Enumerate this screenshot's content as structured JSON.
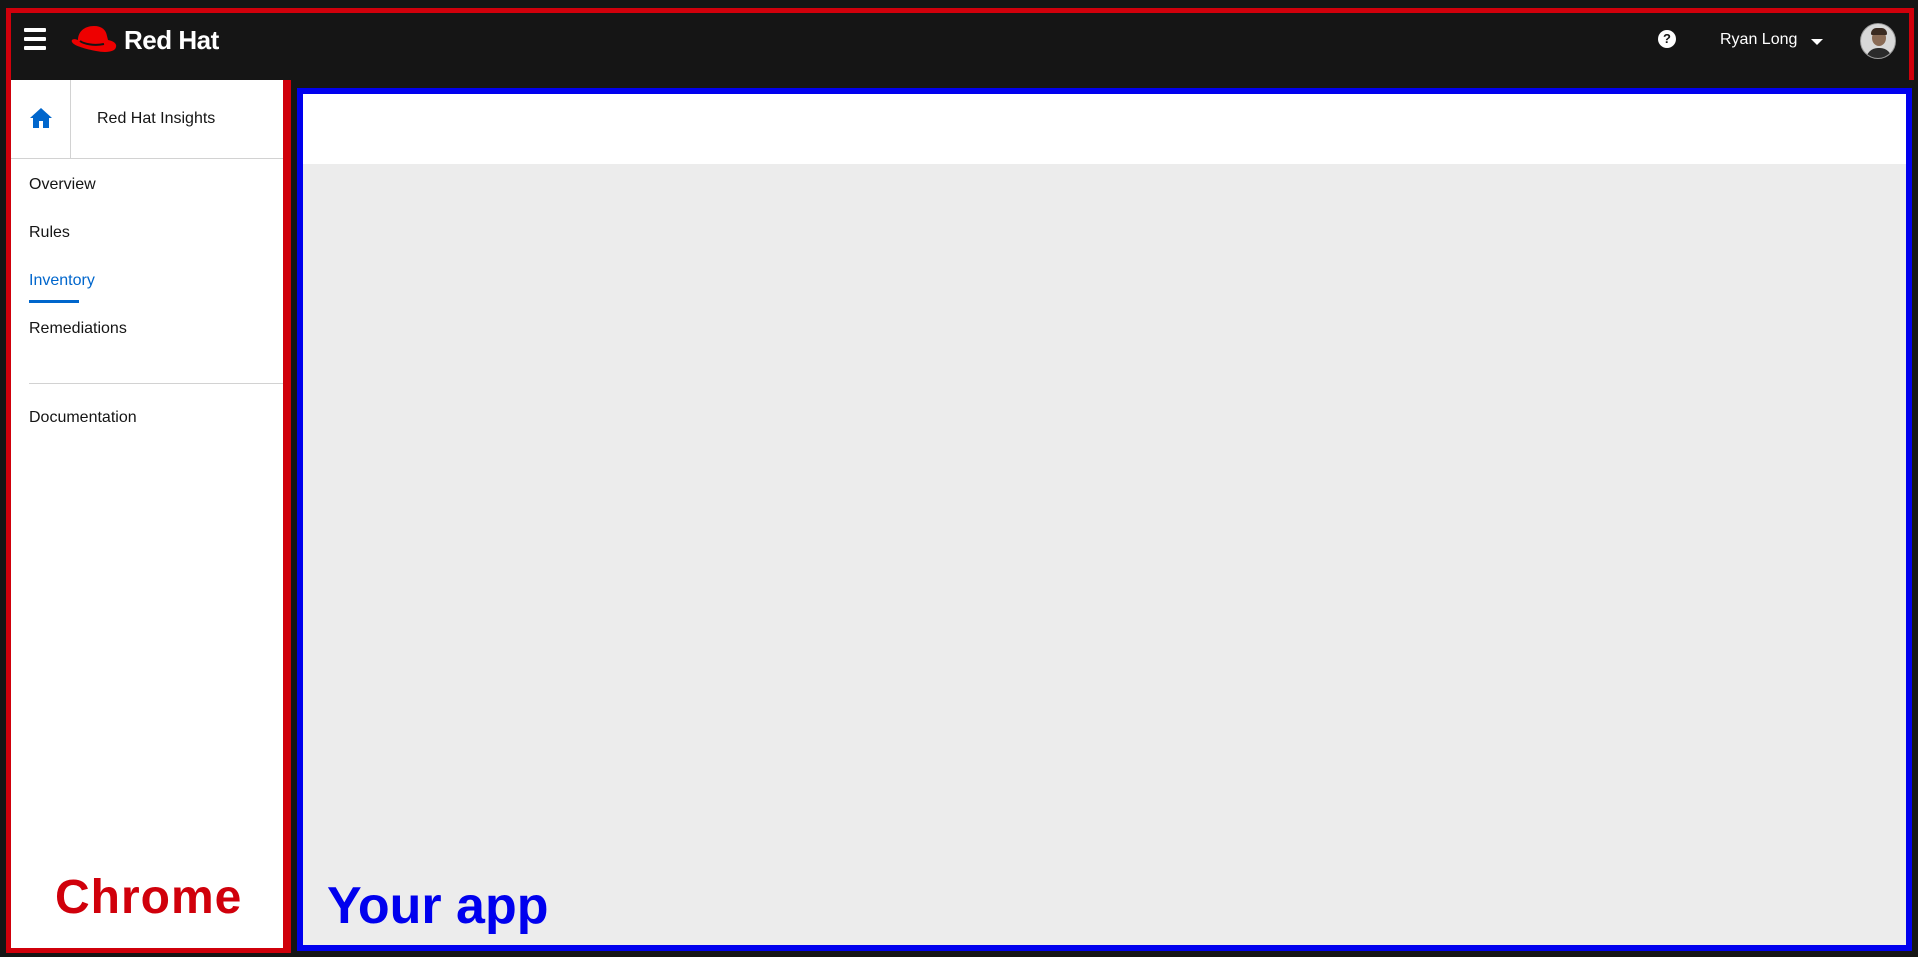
{
  "masthead": {
    "brand": "Red Hat",
    "user_name": "Ryan Long",
    "help_icon": "?",
    "icons": [
      "hamburger-icon",
      "redhat-logo-icon",
      "help-icon",
      "caret-down-icon",
      "avatar"
    ]
  },
  "sidebar": {
    "app_title": "Red Hat Insights",
    "home_icon": "home-icon",
    "items": [
      {
        "label": "Overview",
        "active": false
      },
      {
        "label": "Rules",
        "active": false
      },
      {
        "label": "Inventory",
        "active": true
      },
      {
        "label": "Remediations",
        "active": false
      }
    ],
    "secondary_items": [
      {
        "label": "Documentation"
      }
    ]
  },
  "annotations": {
    "chrome_label": "Chrome",
    "app_label": "Your app",
    "chrome_color": "#d0000b",
    "app_color": "#0000ee"
  },
  "colors": {
    "masthead_bg": "#151515",
    "accent": "#0066cc",
    "content_bg": "#ececec"
  }
}
